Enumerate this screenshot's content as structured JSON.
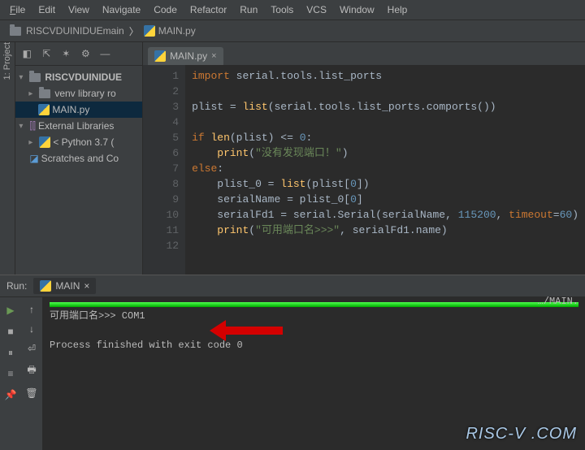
{
  "menu": {
    "file": "File",
    "edit": "Edit",
    "view": "View",
    "navigate": "Navigate",
    "code": "Code",
    "refactor": "Refactor",
    "run": "Run",
    "tools": "Tools",
    "vcs": "VCS",
    "window": "Window",
    "help": "Help"
  },
  "breadcrumbs": {
    "root": "RISCVDUINIDUEmain",
    "file": "MAIN.py"
  },
  "rail": {
    "project": "1: Project"
  },
  "tree": {
    "root": "RISCVDUINIDUE",
    "venv": "venv library ro",
    "main": "MAIN.py",
    "extlib": "External Libraries",
    "python": "< Python 3.7 (",
    "scratches": "Scratches and Co"
  },
  "editor": {
    "tab": "MAIN.py",
    "lines": [
      "1",
      "2",
      "3",
      "4",
      "5",
      "6",
      "7",
      "8",
      "9",
      "10",
      "11",
      "12"
    ],
    "code": {
      "l1a": "import",
      "l1b": " serial.tools.list_ports",
      "l3a": "plist = ",
      "l3b": "list",
      "l3c": "(serial.tools.list_ports.comports())",
      "l5a": "if ",
      "l5b": "len",
      "l5c": "(plist) <= ",
      "l5d": "0",
      "l5e": ":",
      "l6a": "    print",
      "l6b": "(",
      "l6c": "\"没有发现端口！\"",
      "l6d": ")",
      "l7a": "else",
      "l7b": ":",
      "l8a": "    plist_0 = ",
      "l8b": "list",
      "l8c": "(plist[",
      "l8d": "0",
      "l8e": "])",
      "l9a": "    serialName = plist_0[",
      "l9b": "0",
      "l9c": "]",
      "l10a": "    serialFd1 = serial.Serial(serialName",
      "l10b": ", ",
      "l10c": "115200",
      "l10d": ", ",
      "l10e": "timeout",
      "l10f": "=",
      "l10g": "60",
      "l10h": ")",
      "l11a": "    print",
      "l11b": "(",
      "l11c": "\"可用端口名>>>\"",
      "l11d": ", ",
      "l11e": "serialFd1.name)"
    }
  },
  "run": {
    "title": "Run:",
    "tab": "MAIN",
    "line1": "…/MAIN.",
    "line2": "可用端口名>>> COM1",
    "line3": "Process finished with exit code 0"
  },
  "brand": "RISC-V .COM"
}
